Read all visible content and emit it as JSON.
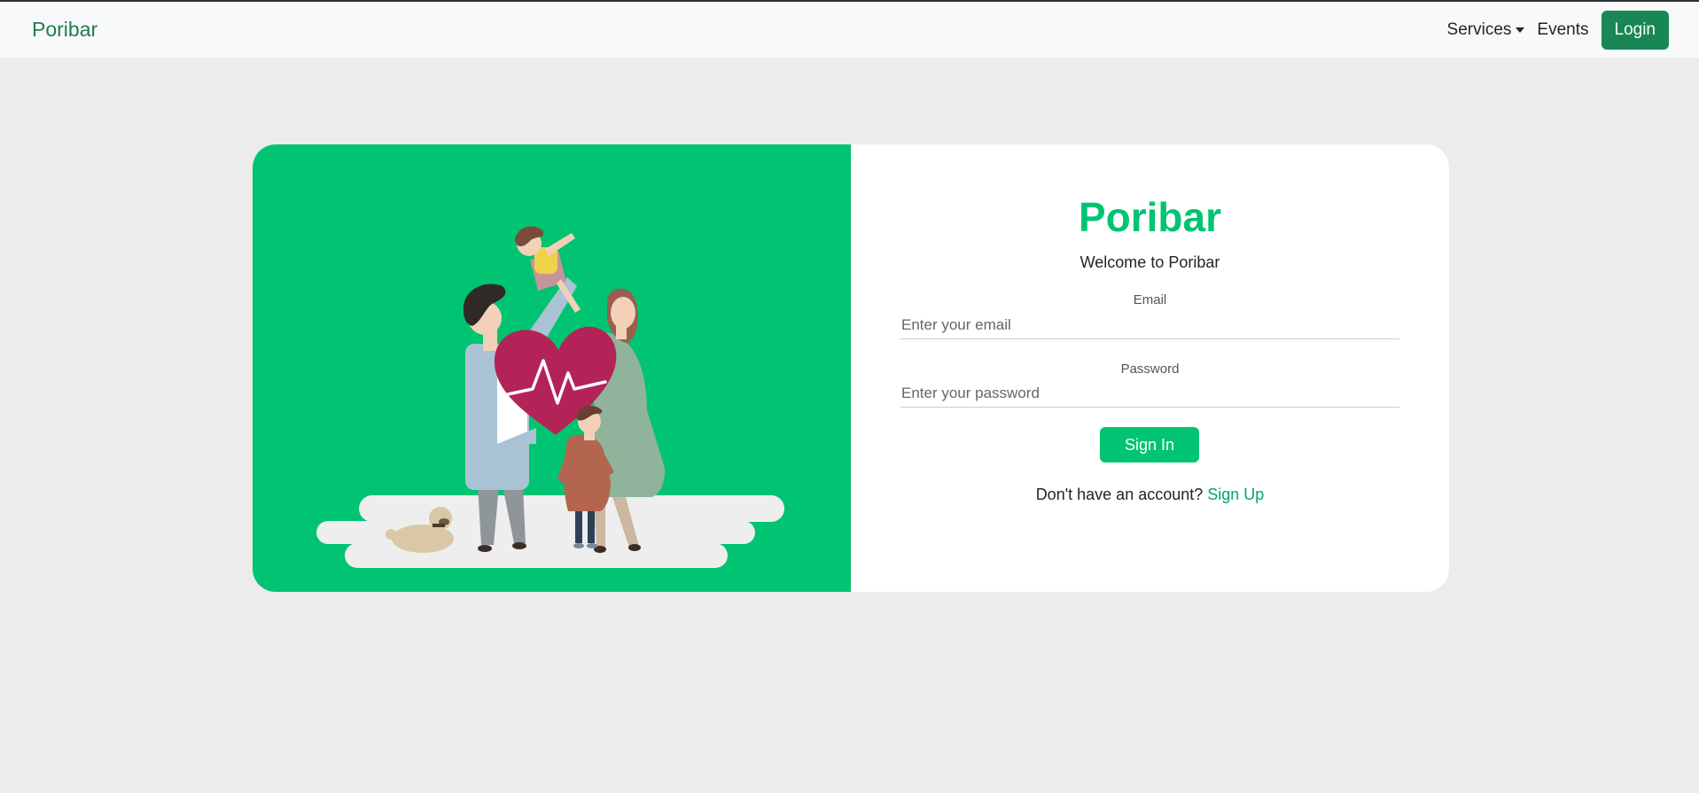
{
  "navbar": {
    "brand": "Poribar",
    "services_label": "Services",
    "events_label": "Events",
    "login_label": "Login"
  },
  "login_card": {
    "title": "Poribar",
    "welcome": "Welcome to Poribar",
    "email_label": "Email",
    "email_placeholder": "Enter your email",
    "email_value": "",
    "password_label": "Password",
    "password_placeholder": "Enter your password",
    "password_value": "",
    "signin_label": "Sign In",
    "no_account_text": "Don't have an account? ",
    "signup_label": "Sign Up"
  },
  "colors": {
    "accent": "#00c472",
    "brand_dark": "#198754",
    "page_background": "#ececec"
  },
  "icons": [
    "caret-down-icon",
    "family-health-illustration"
  ]
}
